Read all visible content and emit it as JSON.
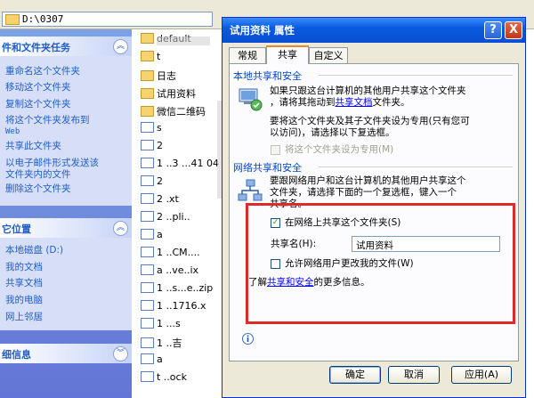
{
  "explorer": {
    "address": "D:\\0307",
    "tasks_panel": {
      "title": "件和文件夹任务",
      "items": [
        "重命名这个文件夹",
        "移动这个文件夹",
        "复制这个文件夹",
        "将这个文件夹发布到",
        "Web",
        "共享此文件夹",
        "以电子邮件形式发送该",
        "文件夹内的文件",
        "删除这个文件夹"
      ]
    },
    "places_panel": {
      "title": "它位置",
      "items": [
        "本地磁盘 (D:)",
        "我的文档",
        "共享文档",
        "我的电脑",
        "网上邻居"
      ]
    },
    "details_panel": {
      "title": "细信息"
    },
    "files": [
      {
        "name": "default",
        "type": "folder"
      },
      {
        "name": "t",
        "type": "folder"
      },
      {
        "name": "日志",
        "type": "folder"
      },
      {
        "name": "试用资料",
        "type": "folder"
      },
      {
        "name": "微信二维码",
        "type": "folder"
      },
      {
        "name": "s",
        "type": "doc"
      },
      {
        "name": "2",
        "type": "doc"
      },
      {
        "name": "1 ..3 ...41 04",
        "type": "doc"
      },
      {
        "name": "2",
        "type": "doc"
      },
      {
        "name": "2 .xt",
        "type": "doc"
      },
      {
        "name": "2 ..pli..",
        "type": "doc"
      },
      {
        "name": "a",
        "type": "doc"
      },
      {
        "name": "1 ..CM....",
        "type": "doc"
      },
      {
        "name": "a ..ve..ix",
        "type": "doc"
      },
      {
        "name": "1 ..s...e..zip",
        "type": "doc"
      },
      {
        "name": "1 ..1716.x",
        "type": "doc"
      },
      {
        "name": "1 ...s",
        "type": "doc"
      },
      {
        "name": "1 ..吉",
        "type": "doc"
      },
      {
        "name": "a",
        "type": "doc"
      },
      {
        "name": "t ..ock",
        "type": "doc"
      }
    ]
  },
  "dialog": {
    "title": "试用资料 属性",
    "help_label": "?",
    "close_label": "X",
    "tabs": [
      "常规",
      "共享",
      "自定义"
    ],
    "active_tab": "共享",
    "local_group": {
      "title": "本地共享和安全",
      "text1a": "如果只跟这台计算机的其他用户共享这个文件夹",
      "text1b_prefix": "，请将其拖动到",
      "text1b_link": "共享文档",
      "text1b_suffix": "文件夹。",
      "text2a": "要将这个文件夹及其子文件夹设为专用(只有您可",
      "text2b": "以访问)，请选择以下复选框。",
      "private_checkbox": "将这个文件夹设为专用(M)",
      "private_checked": false
    },
    "network_group": {
      "title": "网络共享和安全",
      "text_a": "要跟网络用户和这台计算机的其他用户共享这个",
      "text_b": "文件夹，请选择下面的一个复选框，键入一个",
      "text_c": "共享名。",
      "share_checkbox": "在网络上共享这个文件夹(S)",
      "share_checked": true,
      "share_name_label": "共享名(H):",
      "share_name_value": "试用资料",
      "allow_change_checkbox": "允许网络用户更改我的文件(W)",
      "allow_change_checked": false
    },
    "learn_more_prefix": "了解",
    "learn_more_link": "共享和安全",
    "learn_more_suffix": "的更多信息。",
    "buttons": {
      "ok": "确定",
      "cancel": "取消",
      "apply": "应用(A)"
    },
    "colors": {
      "highlight_box": "#e02a2a",
      "title_bar": "#0a4fd1",
      "group_label": "#0046d5",
      "link": "#0000ff"
    }
  }
}
